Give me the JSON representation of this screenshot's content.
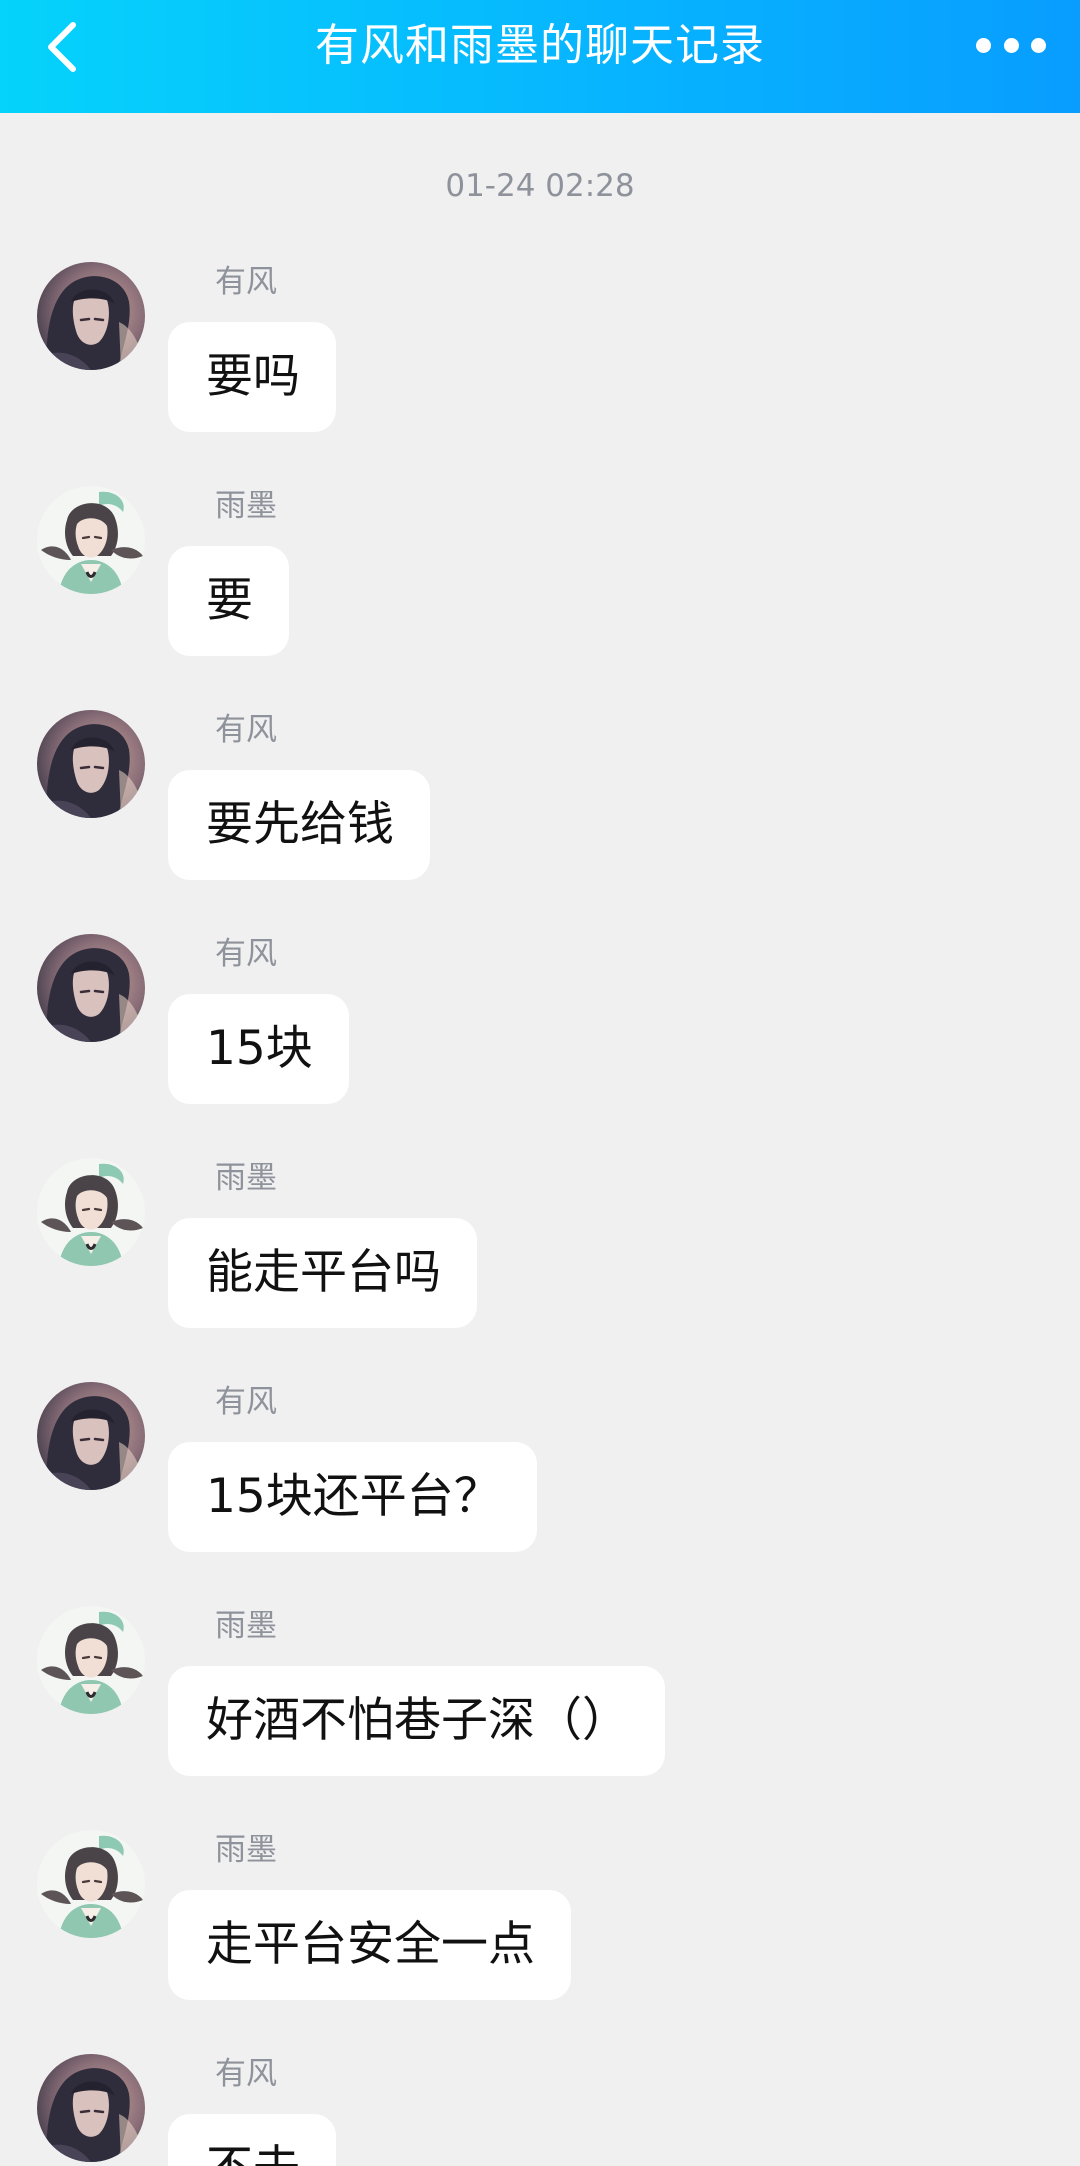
{
  "header": {
    "title": "有风和雨墨的聊天记录",
    "back_icon": "chevron-left-icon",
    "more_icon": "more-horizontal-icon",
    "gradient": [
      "#05d3fb",
      "#089dff"
    ]
  },
  "timestamp": "01-24 02:28",
  "messages": [
    {
      "sender": "有风",
      "avatar": "youfeng",
      "text": "要吗"
    },
    {
      "sender": "雨墨",
      "avatar": "yumo",
      "text": "要"
    },
    {
      "sender": "有风",
      "avatar": "youfeng",
      "text": "要先给钱"
    },
    {
      "sender": "有风",
      "avatar": "youfeng",
      "text": "15块"
    },
    {
      "sender": "雨墨",
      "avatar": "yumo",
      "text": "能走平台吗"
    },
    {
      "sender": "有风",
      "avatar": "youfeng",
      "text": "15块还平台？"
    },
    {
      "sender": "雨墨",
      "avatar": "yumo",
      "text": "好酒不怕巷子深（）"
    },
    {
      "sender": "雨墨",
      "avatar": "yumo",
      "text": "走平台安全一点"
    },
    {
      "sender": "有风",
      "avatar": "youfeng",
      "text": "不去"
    }
  ],
  "colors": {
    "background": "#f0f0f0",
    "bubble": "#ffffff",
    "meta_text": "#8e929b",
    "message_text": "#111111"
  }
}
